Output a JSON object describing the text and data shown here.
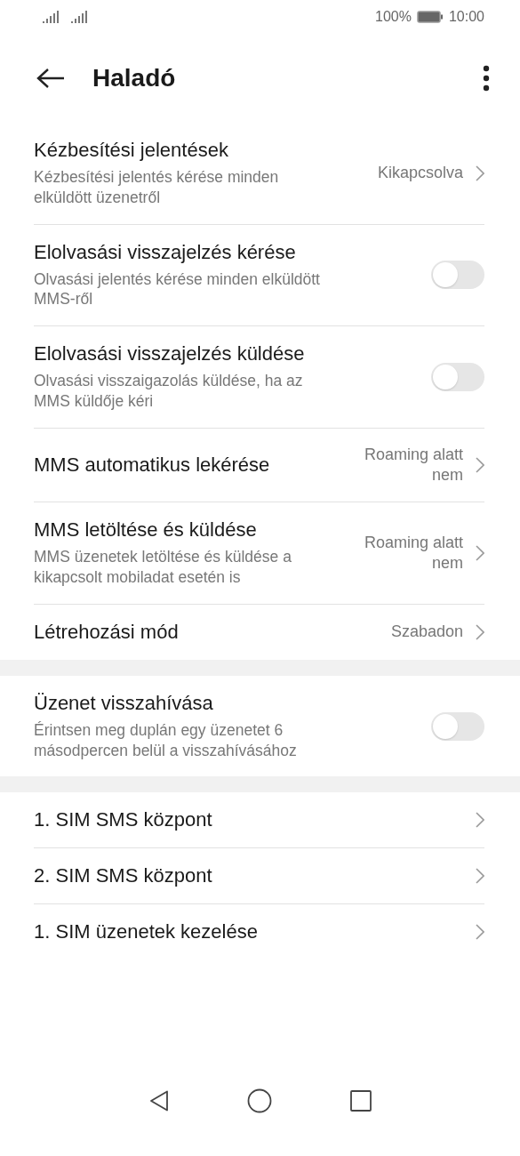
{
  "status_bar": {
    "battery_text": "100%",
    "time": "10:00"
  },
  "header": {
    "title": "Haladó"
  },
  "groups": [
    {
      "rows": [
        {
          "kind": "link",
          "title": "Kézbesítési jelentések",
          "subtitle": "Kézbesítési jelentés kérése minden elküldött üzenetről",
          "value": "Kikapcsolva"
        },
        {
          "kind": "switch",
          "title": "Elolvasási visszajelzés kérése",
          "subtitle": "Olvasási jelentés kérése minden elküldött MMS-ről",
          "checked": false
        },
        {
          "kind": "switch",
          "title": "Elolvasási visszajelzés küldése",
          "subtitle": "Olvasási visszaigazolás küldése, ha az MMS küldője kéri",
          "checked": false
        },
        {
          "kind": "link",
          "title": "MMS automatikus lekérése",
          "value": "Roaming alatt nem"
        },
        {
          "kind": "link",
          "title": "MMS letöltése és küldése",
          "subtitle": "MMS üzenetek letöltése és küldése a kikapcsolt mobiladat esetén is",
          "value": "Roaming alatt nem"
        },
        {
          "kind": "link",
          "title": "Létrehozási mód",
          "value": "Szabadon"
        }
      ]
    },
    {
      "rows": [
        {
          "kind": "switch",
          "title": "Üzenet visszahívása",
          "subtitle": "Érintsen meg duplán egy üzenetet 6 másodpercen belül a visszahívásához",
          "checked": false
        }
      ]
    },
    {
      "rows": [
        {
          "kind": "link",
          "title": "1. SIM SMS központ"
        },
        {
          "kind": "link",
          "title": "2. SIM SMS központ"
        },
        {
          "kind": "link",
          "title": "1. SIM üzenetek kezelése"
        }
      ]
    }
  ]
}
